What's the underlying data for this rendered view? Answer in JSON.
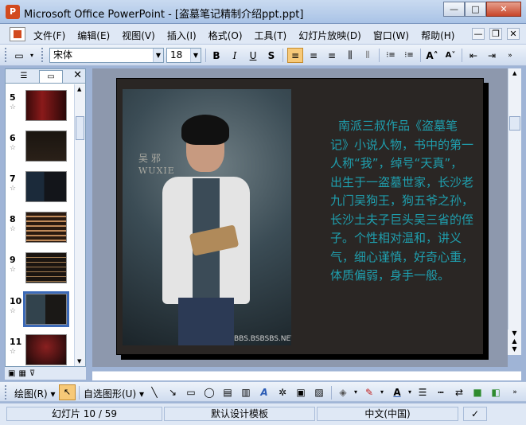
{
  "window": {
    "title": "Microsoft Office PowerPoint - [盗墓笔记精制介绍ppt.ppt]",
    "app_icon_letter": "P",
    "minimize": "—",
    "maximize": "□",
    "close": "✕"
  },
  "menu": {
    "items": [
      "文件(F)",
      "编辑(E)",
      "视图(V)",
      "插入(I)",
      "格式(O)",
      "工具(T)",
      "幻灯片放映(D)",
      "窗口(W)",
      "帮助(H)"
    ],
    "doc_min": "—",
    "doc_restore": "❐",
    "doc_close": "✕"
  },
  "format_toolbar": {
    "font_name": "宋体",
    "font_size": "18",
    "bold": "B",
    "italic": "I",
    "underline": "U",
    "shadow": "S",
    "align_left": "≡",
    "align_center": "≡",
    "align_right": "≡",
    "distributed": "⫼",
    "numbered_list": "⁝≡",
    "bullet_list": "⁝≡",
    "grow_font": "A˄",
    "shrink_font": "A˅",
    "decrease_indent": "⇤",
    "increase_indent": "⇥"
  },
  "left_pane": {
    "tab_outline": "☰",
    "tab_slides": "▭",
    "close": "✕",
    "thumbnails": [
      {
        "num": "5",
        "star": "☆"
      },
      {
        "num": "6",
        "star": "☆"
      },
      {
        "num": "7",
        "star": "☆"
      },
      {
        "num": "8",
        "star": "☆"
      },
      {
        "num": "9",
        "star": "☆"
      },
      {
        "num": "10",
        "star": "☆"
      },
      {
        "num": "11",
        "star": "☆"
      }
    ],
    "selected_index": 5
  },
  "view_buttons": [
    "▣",
    "▦",
    "🝖"
  ],
  "slide": {
    "caption_cn": "吴 邪",
    "caption_en": "WUXIE",
    "watermark": "BBS.BSBSBS.NET",
    "body": "南派三叔作品《盗墓笔记》小说人物，书中的第一人称“我”，绰号“天真”，出生于一盗墓世家，长沙老九门吴狗王，狗五爷之孙，长沙土夫子巨头吴三省的侄子。个性相对温和，讲义气，细心谨慎，好奇心重，体质偏弱，身手一般。",
    "text_color": "#1f9fae"
  },
  "draw_toolbar": {
    "draw": "绘图(R) ▾",
    "autoshapes": "自选图形(U) ▾"
  },
  "status": {
    "slide_position": "幻灯片 10 / 59",
    "template": "默认设计模板",
    "language": "中文(中国)"
  }
}
